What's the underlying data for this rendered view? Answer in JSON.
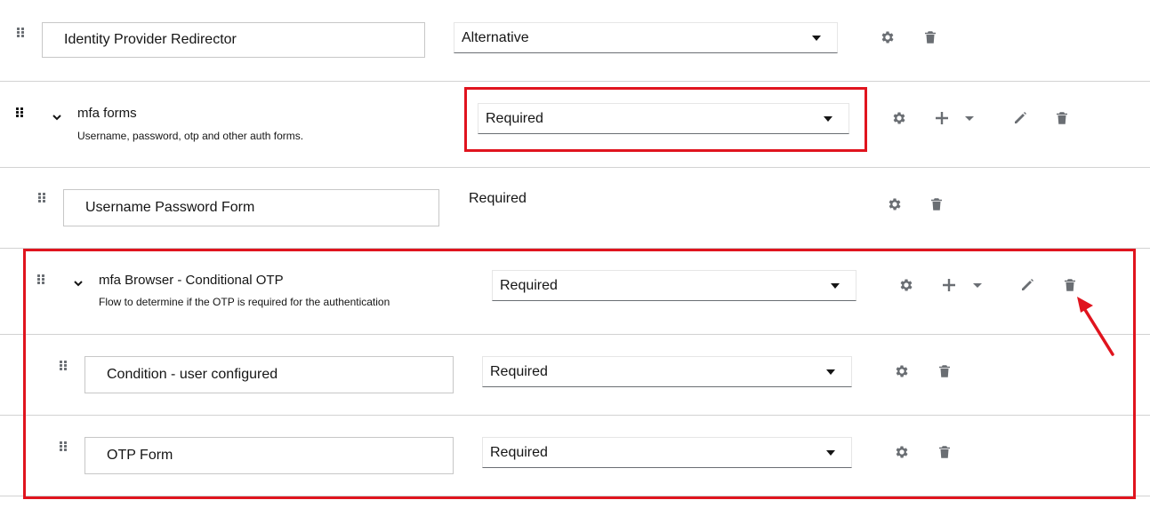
{
  "rows": [
    {
      "type": "step",
      "name": "Identity Provider Redirector",
      "requirement": "Alternative"
    },
    {
      "type": "flow",
      "title": "mfa forms",
      "description": "Username, password, otp and other auth forms.",
      "requirement": "Required"
    },
    {
      "type": "step",
      "name": "Username Password Form",
      "requirement": "Required"
    },
    {
      "type": "flow",
      "title": "mfa Browser - Conditional OTP",
      "description": "Flow to determine if the OTP is required for the authentication",
      "requirement": "Required"
    },
    {
      "type": "step",
      "name": "Condition - user configured",
      "requirement": "Required"
    },
    {
      "type": "step",
      "name": "OTP Form",
      "requirement": "Required"
    }
  ],
  "icons": {
    "drag": "drag-handle-icon",
    "expand": "chevron-down-icon",
    "settings": "gear-icon",
    "add": "plus-icon",
    "add_menu": "caret-down-icon",
    "edit": "pencil-icon",
    "delete": "trash-icon"
  },
  "colors": {
    "highlight": "#e0141e",
    "icon": "#6a6e73",
    "divider": "#d2d2d2"
  }
}
